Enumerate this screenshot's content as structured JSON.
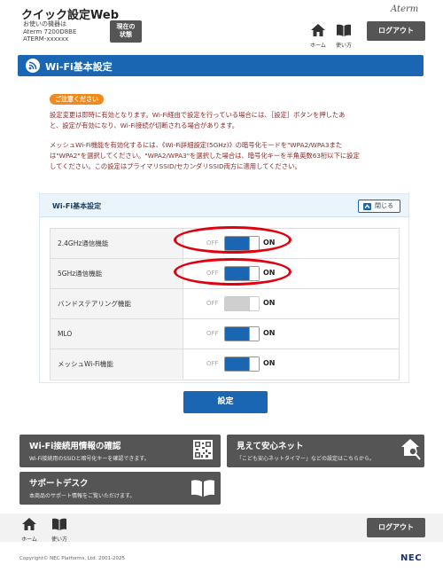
{
  "header": {
    "app_title": "クイック設定Web",
    "device_label": "お使いの機器は",
    "device_model": "Aterm 7200D8BE",
    "device_id": "ATERM-xxxxxx",
    "status_btn_line1": "現在の",
    "status_btn_line2": "状態",
    "brand": "Aterm",
    "home_label": "ホーム",
    "help_label": "使い方",
    "logout_label": "ログアウト"
  },
  "section": {
    "title": "Wi-Fi基本設定"
  },
  "notice": {
    "badge": "ご注意ください",
    "lines": [
      "設定変更は即時に有効となります。Wi-Fi経由で設定を行っている場合には、［設定］ボタンを押したあ",
      "と、設定が有効になり、Wi-Fi接続が切断される場合があります。",
      "メッシュWi-Fi機能を有効化するには、《Wi-Fi詳細設定(5GHz)》の暗号化モードを\"WPA2/WPA3また",
      "は\"WPA2\"を選択してください。\"WPA2/WPA3\"を選択した場合は、暗号化キーを半角英数63桁以下に設定",
      "してください。この設定はプライマリSSID/セカンダリSSID両方に適用してください。"
    ]
  },
  "panel": {
    "title": "Wi-Fi基本設定",
    "collapse_label": "閉じる",
    "rows": [
      {
        "label": "2.4GHz通信機能",
        "off": "OFF",
        "on": "ON",
        "state": "on",
        "enabled": true
      },
      {
        "label": "5GHz通信機能",
        "off": "OFF",
        "on": "ON",
        "state": "on",
        "enabled": true
      },
      {
        "label": "バンドステアリング機能",
        "off": "OFF",
        "on": "ON",
        "state": "on",
        "enabled": false
      },
      {
        "label": "MLO",
        "off": "OFF",
        "on": "ON",
        "state": "on",
        "enabled": true
      },
      {
        "label": "メッシュWi-Fi機能",
        "off": "OFF",
        "on": "ON",
        "state": "on",
        "enabled": true
      }
    ]
  },
  "apply_label": "設定",
  "cards": {
    "wifi_info": {
      "title": "Wi-Fi接続用情報の確認",
      "desc": "Wi-Fi接続用のSSIDと暗号化キーを確認できます。"
    },
    "safety_net": {
      "title": "見えて安心ネット",
      "desc": "「こども安心ネットタイマー」などの設定はこちらから。"
    },
    "support": {
      "title": "サポートデスク",
      "desc": "本商品のサポート情報をご覧いただけます。"
    }
  },
  "footer": {
    "home_label": "ホーム",
    "help_label": "使い方",
    "logout_label": "ログアウト",
    "copyright": "Copyright© NEC Platforms, Ltd. 2001-2025",
    "nec": "NEC"
  },
  "colors": {
    "accent": "#1a66b2",
    "dark_button": "#555555",
    "notice_text": "#8a2a2a",
    "badge": "#f08a1c",
    "highlight_ring": "#e10010"
  },
  "icons": [
    "wifi-icon",
    "home-icon",
    "book-icon",
    "qr-code-icon",
    "house-search-icon",
    "open-book-icon",
    "chevron-up-icon"
  ]
}
